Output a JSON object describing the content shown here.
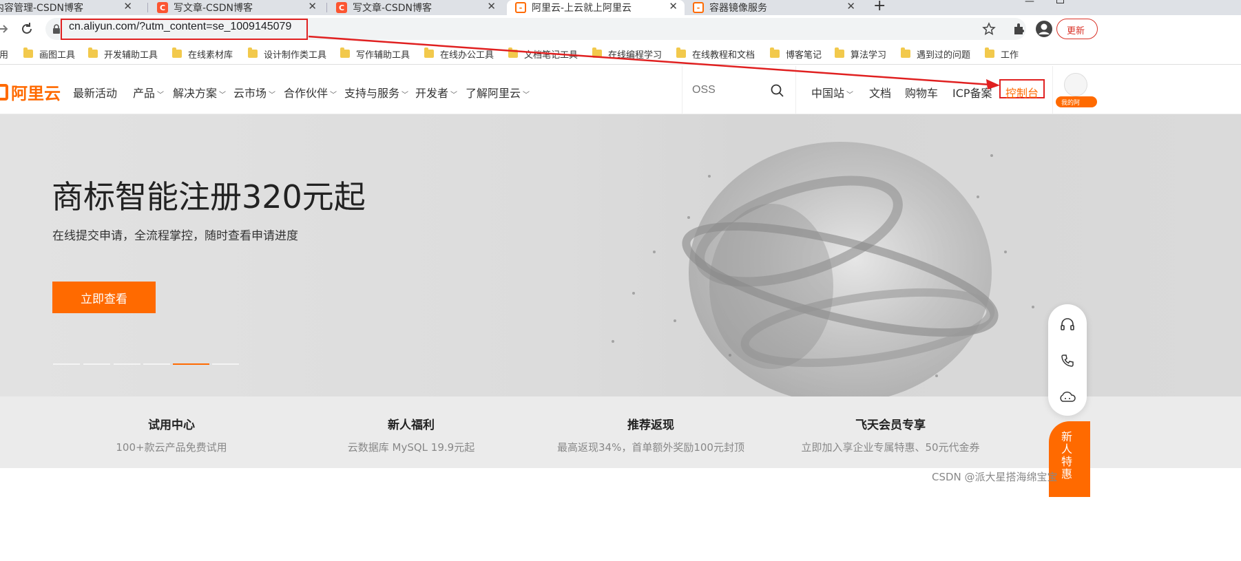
{
  "browser": {
    "tabs": [
      {
        "title": "内容管理-CSDN博客",
        "active": false
      },
      {
        "title": "写文章-CSDN博客",
        "active": false
      },
      {
        "title": "写文章-CSDN博客",
        "active": false
      },
      {
        "title": "阿里云-上云就上阿里云",
        "active": true
      },
      {
        "title": "容器镜像服务",
        "active": false
      }
    ],
    "new_tab": "+",
    "url": "cn.aliyun.com/?utm_content=se_1009145079",
    "update_label": "更新",
    "bookmarks": [
      "应用",
      "画图工具",
      "开发辅助工具",
      "在线素材库",
      "设计制作类工具",
      "写作辅助工具",
      "在线办公工具",
      "文档笔记工具",
      "在线编程学习",
      "在线教程和文档",
      "博客笔记",
      "算法学习",
      "遇到过的问题",
      "工作"
    ]
  },
  "site": {
    "logo": "阿里云",
    "nav": [
      "最新活动",
      "产品",
      "解决方案",
      "云市场",
      "合作伙伴",
      "支持与服务",
      "开发者",
      "了解阿里云"
    ],
    "search_placeholder": "OSS",
    "right_links": [
      "中国站",
      "文档",
      "购物车",
      "ICP备案",
      "控制台"
    ],
    "avatar_label": "我的阿"
  },
  "hero": {
    "title": "商标智能注册320元起",
    "subtitle": "在线提交申请，全流程掌控，随时查看申请进度",
    "button": "立即查看",
    "active_slide": 5,
    "slide_count": 6
  },
  "features": [
    {
      "title": "试用中心",
      "desc": "100+款云产品免费试用"
    },
    {
      "title": "新人福利",
      "desc": "云数据库 MySQL 19.9元起"
    },
    {
      "title": "推荐返现",
      "desc": "最高返现34%，首单额外奖励100元封顶"
    },
    {
      "title": "飞天会员专享",
      "desc": "立即加入享企业专属特惠、50元代金券"
    }
  ],
  "float": {
    "newbie": "新人特惠"
  },
  "watermark": "CSDN @派大星搭海绵宝宝",
  "colors": {
    "brand": "#ff6a00",
    "annotation": "#e02020"
  }
}
